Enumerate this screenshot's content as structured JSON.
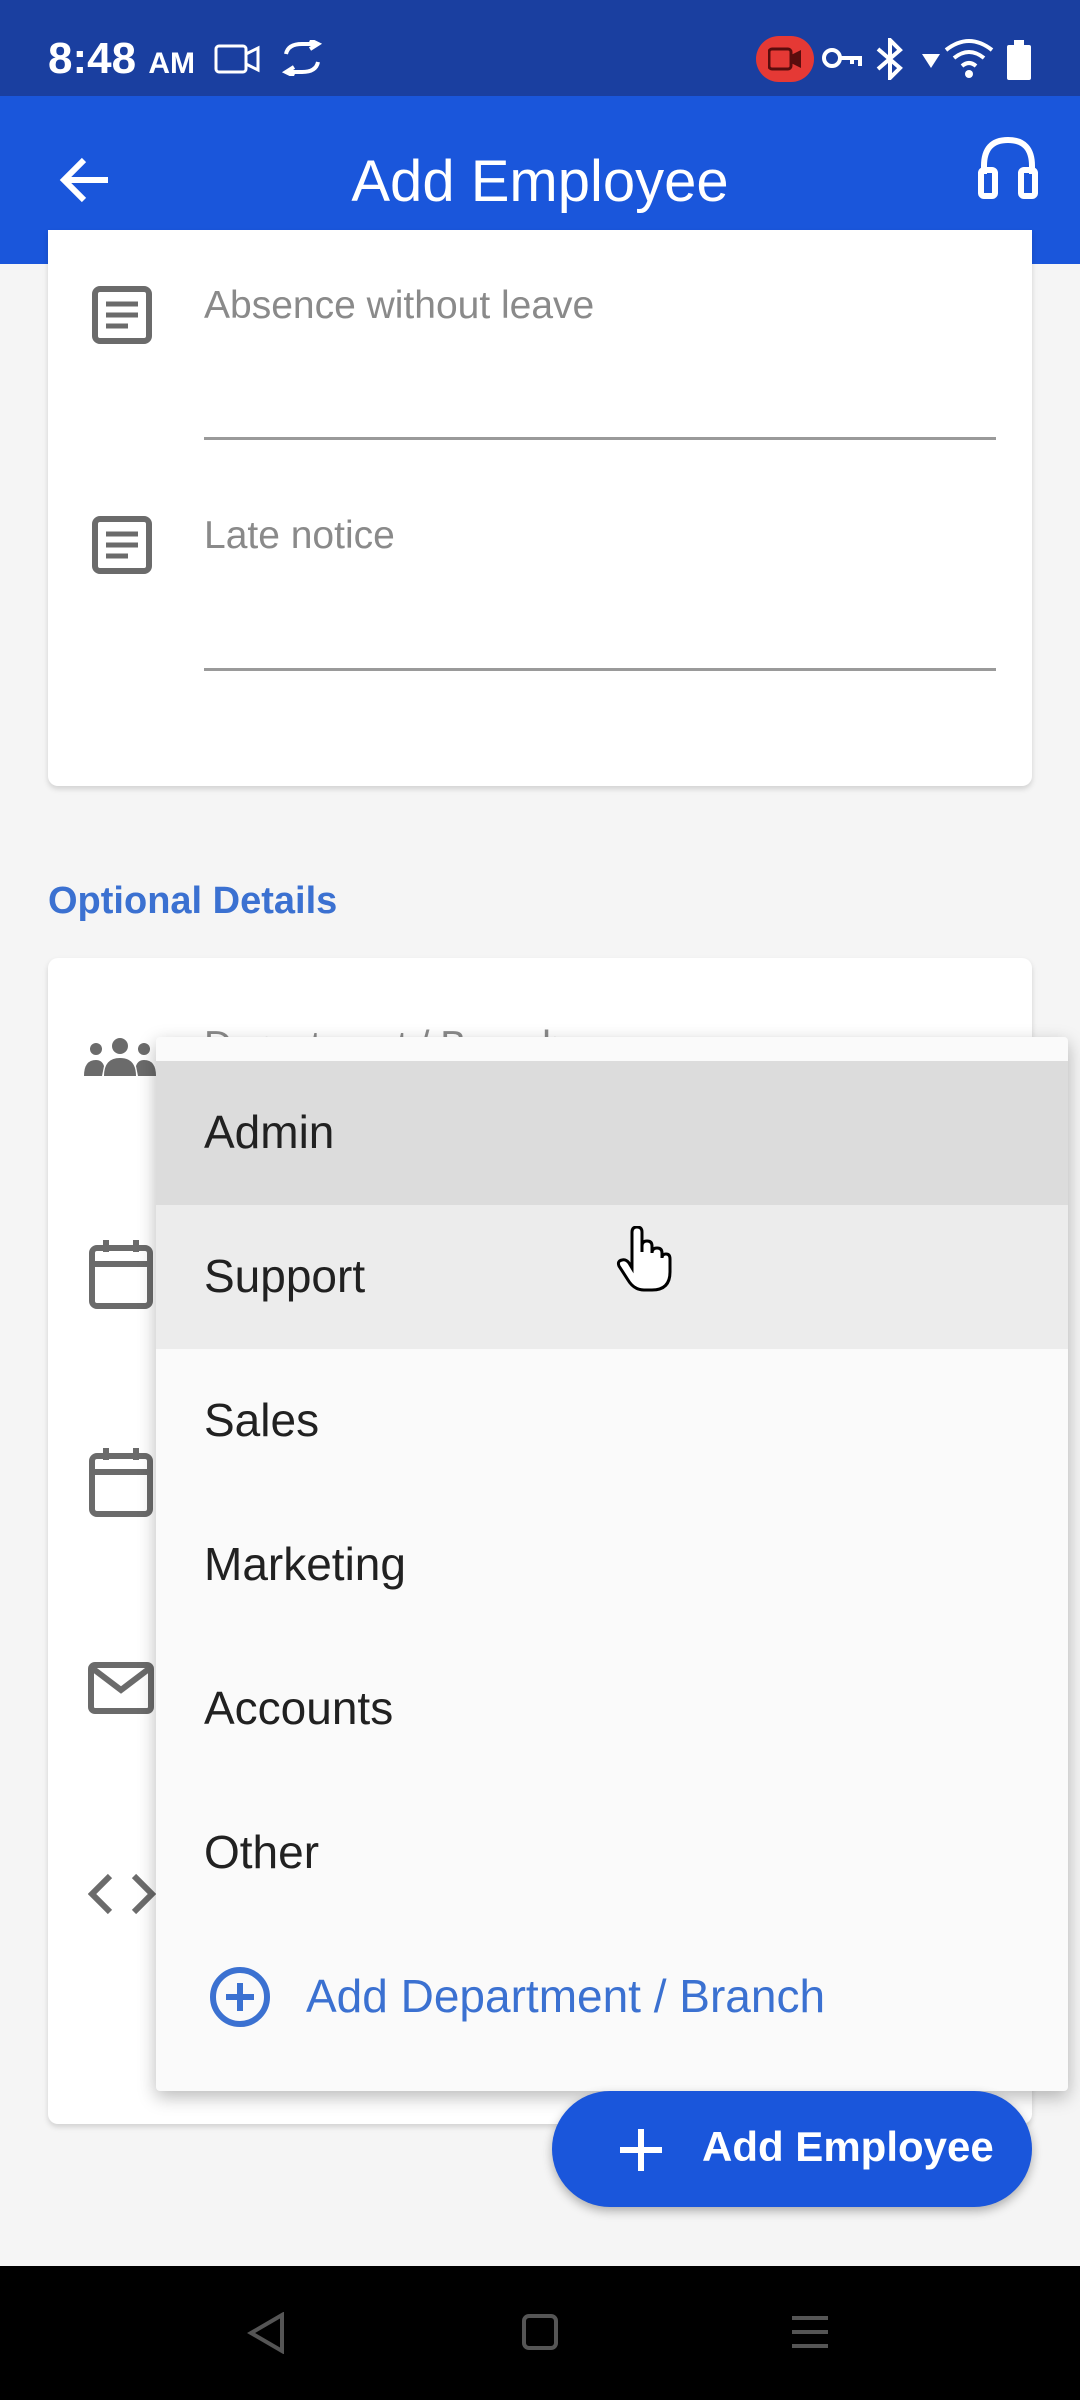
{
  "status_bar": {
    "time": "8:48",
    "ampm": "AM"
  },
  "app_bar": {
    "title": "Add Employee",
    "back_icon": "arrow-left-icon",
    "support_icon": "headset-icon"
  },
  "fields": {
    "absence": {
      "placeholder": "Absence without leave",
      "icon": "notes-icon"
    },
    "late": {
      "placeholder": "Late notice",
      "icon": "notes-icon"
    }
  },
  "optional": {
    "title": "Optional Details",
    "department_placeholder": "Department / Branch"
  },
  "dropdown": {
    "items": [
      "Admin",
      "Support",
      "Sales",
      "Marketing",
      "Accounts",
      "Other"
    ],
    "add_label": "Add Department / Branch"
  },
  "fab": {
    "label": "Add Employee",
    "icon": "plus-icon"
  },
  "colors": {
    "primary": "#1a56db",
    "status_bar": "#1a3fa0",
    "link": "#3b71d1"
  }
}
